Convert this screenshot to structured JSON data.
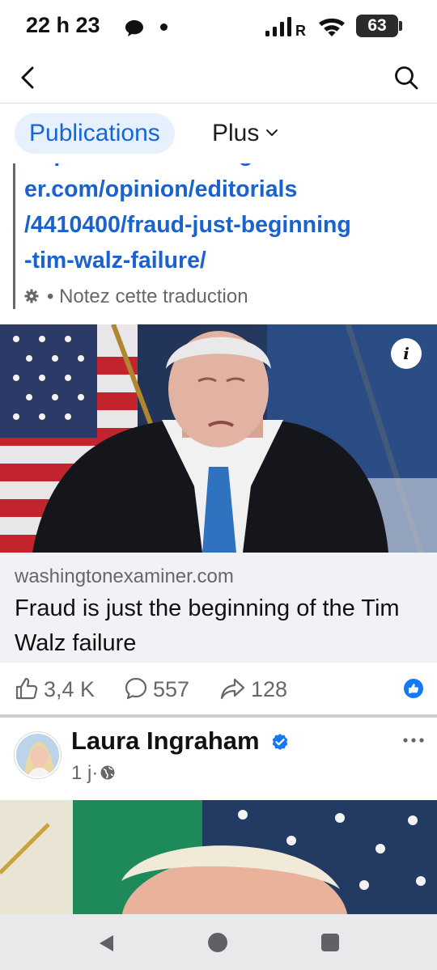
{
  "status_bar": {
    "time": "22 h 23",
    "carrier_letter": "R",
    "battery": "63",
    "icons": [
      "message-icon",
      "signal-icon",
      "wifi-icon",
      "battery-icon"
    ]
  },
  "nav": {
    "icons": [
      "back-arrow-icon",
      "search-icon"
    ]
  },
  "tabs": [
    {
      "label": "Publications",
      "selected": true
    },
    {
      "label": "Plus",
      "selected": false
    }
  ],
  "post": {
    "link_lines": [
      "https://www.washingtonexamin",
      "er.com/opinion/editorials",
      "/4410400/fraud-just-beginning",
      "-tim-walz-failure/"
    ],
    "translate_separator": "•",
    "translate_label": "Notez cette traduction",
    "link_card": {
      "domain": "washingtonexaminer.com",
      "title": "Fraud is just the beginning of the Tim Walz failure",
      "info_label": "i"
    },
    "reactions": {
      "likes": "3,4 K",
      "comments": "557",
      "shares": "128"
    }
  },
  "next_post": {
    "author": "Laura Ingraham",
    "time": "1 j",
    "time_separator": "·",
    "verified": true
  },
  "colors": {
    "accent": "#1467d9",
    "link": "#1a62cc",
    "muted": "#65676b",
    "tab_bg": "#e7f0fd",
    "card_bg": "#f0f2f5",
    "like_blue": "#1877f2"
  }
}
